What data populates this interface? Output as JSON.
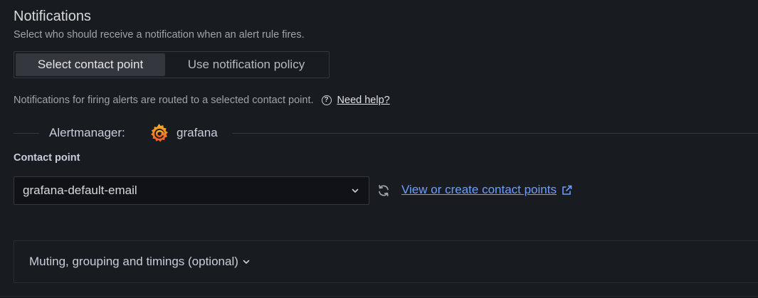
{
  "section": {
    "title": "Notifications",
    "subtitle": "Select who should receive a notification when an alert rule fires."
  },
  "routing_mode": {
    "options": [
      "Select contact point",
      "Use notification policy"
    ],
    "selected": "Select contact point"
  },
  "info": {
    "text": "Notifications for firing alerts are routed to a selected contact point.",
    "help_link": "Need help?",
    "help_icon": "question-circle-icon"
  },
  "alertmanager": {
    "label": "Alertmanager:",
    "name": "grafana",
    "logo": "grafana-logo",
    "logo_color": "#f46800"
  },
  "contact_point": {
    "label": "Contact point",
    "value": "grafana-default-email",
    "refresh_icon": "sync-icon",
    "link_label": "View or create contact points",
    "link_icon": "external-link-icon",
    "link_color": "#6e9fff"
  },
  "advanced": {
    "label": "Muting, grouping and timings (optional)",
    "icon": "chevron-down-icon"
  }
}
